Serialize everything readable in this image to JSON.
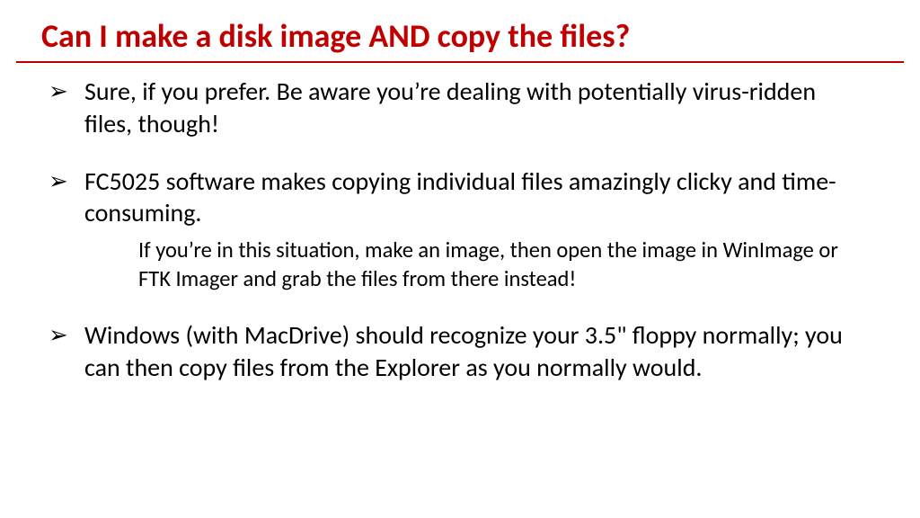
{
  "slide": {
    "title": "Can I make a disk image AND copy the files?",
    "bullets": [
      {
        "text": "Sure, if you prefer. Be aware you’re dealing with potentially virus-ridden files, though!",
        "sub": null
      },
      {
        "text": "FC5025 software makes copying individual files amazingly clicky and time-consuming.",
        "sub": "If you’re in this situation, make an image, then open the image in WinImage or FTK Imager and grab the files from there instead!"
      },
      {
        "text": "Windows (with MacDrive) should recognize your 3.5\" floppy normally; you can then copy files from the Explorer as you normally would.",
        "sub": null
      }
    ]
  }
}
